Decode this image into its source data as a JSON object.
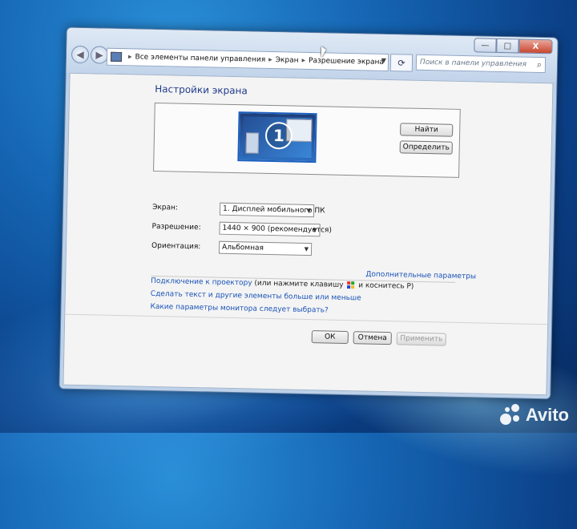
{
  "address": {
    "path": [
      "Все элементы панели управления",
      "Экран",
      "Разрешение экрана"
    ],
    "separator": "▸",
    "search_placeholder": "Поиск в панели управления"
  },
  "window_controls": {
    "minimize": "—",
    "maximize": "□",
    "close": "X"
  },
  "page": {
    "title": "Настройки экрана",
    "monitor_number": "1",
    "find_button": "Найти",
    "identify_button": "Определить"
  },
  "fields": {
    "display_label": "Экран:",
    "display_value": "1. Дисплей мобильного ПК",
    "resolution_label": "Разрешение:",
    "resolution_value": "1440 × 900 (рекомендуется)",
    "orientation_label": "Ориентация:",
    "orientation_value": "Альбомная"
  },
  "links": {
    "advanced": "Дополнительные параметры",
    "projector": "Подключение к проектору",
    "projector_hint_pre": "(или нажмите клавишу",
    "projector_hint_post": "и коснитесь P)",
    "text_size": "Сделать текст и другие элементы больше или меньше",
    "which_params": "Какие параметры монитора следует выбрать?"
  },
  "footer": {
    "ok": "ОК",
    "cancel": "Отмена",
    "apply": "Применить"
  },
  "watermark": {
    "text": "Avito"
  }
}
